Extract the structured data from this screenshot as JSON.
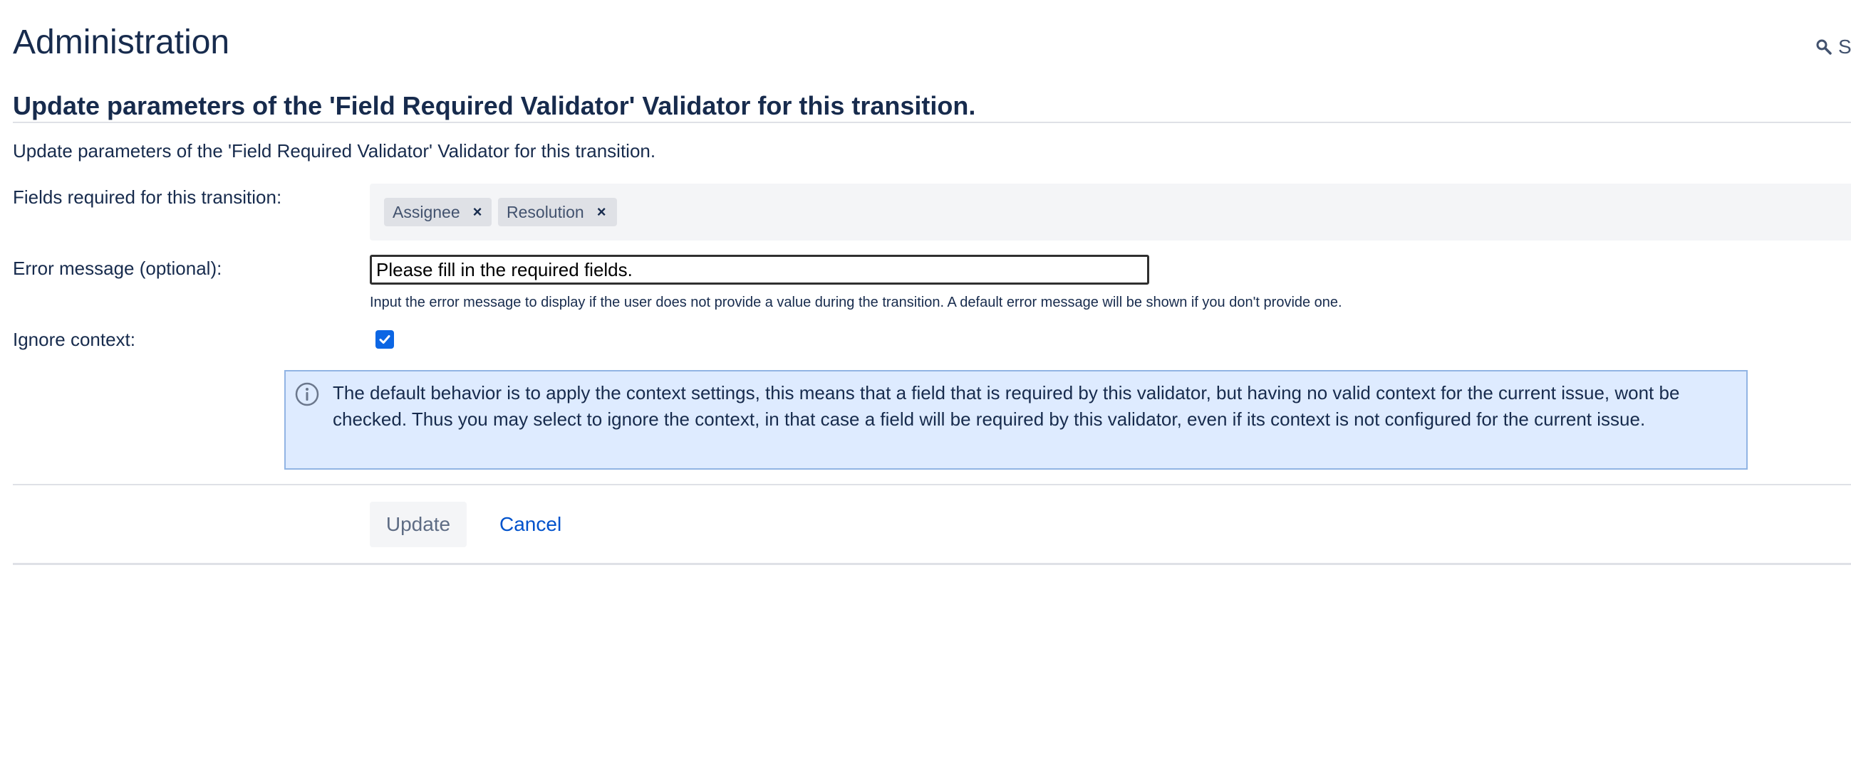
{
  "header": {
    "title": "Administration",
    "search_label": "S",
    "search_icon": "search-icon"
  },
  "form": {
    "heading": "Update parameters of the 'Field Required Validator' Validator for this transition.",
    "description": "Update parameters of the 'Field Required Validator' Validator for this transition.",
    "fields_required": {
      "label": "Fields required for this transition:",
      "tags": [
        {
          "label": "Assignee"
        },
        {
          "label": "Resolution"
        }
      ],
      "remove_glyph": "×"
    },
    "error_message": {
      "label": "Error message (optional):",
      "value": "Please fill in the required fields.",
      "help": "Input the error message to display if the user does not provide a value during the transition. A default error message will be shown if you don't provide one."
    },
    "ignore_context": {
      "label": "Ignore context:",
      "checked": true
    },
    "info": {
      "icon": "info-icon",
      "text": "The default behavior is to apply the context settings, this means that a field that is required by this validator, but having no valid context for the current issue, wont be checked. Thus you may select to ignore the context, in that case a field will be required by this validator, even if its context is not configured for the current issue."
    },
    "buttons": {
      "update_label": "Update",
      "cancel_label": "Cancel"
    }
  },
  "colors": {
    "text": "#172b4d",
    "info_background": "#deebff",
    "info_border": "#91b4e4",
    "link": "#0052cc",
    "checkbox": "#0c66e4"
  }
}
